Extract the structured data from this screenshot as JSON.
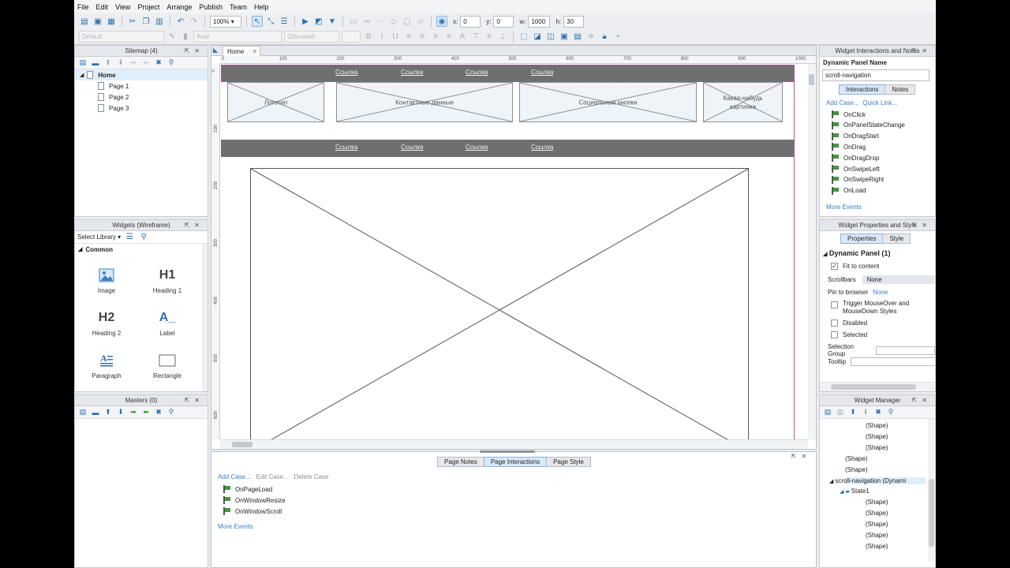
{
  "menu": [
    "File",
    "Edit",
    "View",
    "Project",
    "Arrange",
    "Publish",
    "Team",
    "Help"
  ],
  "toolbar": {
    "zoom": "100%",
    "x_label": "x:",
    "x_value": "0",
    "y_label": "y:",
    "y_value": "0",
    "w_label": "w:",
    "w_value": "1000",
    "h_label": "h:",
    "h_value": "30",
    "style_default": "Default",
    "font": "Arial",
    "font_weight": "Обычный"
  },
  "sitemap": {
    "title": "Sitemap (4)",
    "home": "Home",
    "pages": [
      "Page 1",
      "Page 2",
      "Page 3"
    ]
  },
  "widgets": {
    "title": "Widgets (Wireframe)",
    "select_library": "Select Library",
    "section": "Common",
    "items": [
      {
        "glyph": "",
        "label": "Image"
      },
      {
        "glyph": "H1",
        "label": "Heading 1"
      },
      {
        "glyph": "H2",
        "label": "Heading 2"
      },
      {
        "glyph": "A_",
        "label": "Label"
      },
      {
        "glyph": "",
        "label": "Paragraph"
      },
      {
        "glyph": "",
        "label": "Rectangle"
      }
    ]
  },
  "masters": {
    "title": "Masters (0)"
  },
  "canvas": {
    "tab": "Home",
    "ruler_h": [
      "0",
      "100",
      "200",
      "300",
      "400",
      "500",
      "600",
      "700",
      "800",
      "900",
      "1000"
    ],
    "ruler_v": [
      "0",
      "100",
      "200",
      "300",
      "400",
      "500",
      "600"
    ],
    "nav_links": [
      "Ссылка",
      "Ссылка",
      "Ссылка",
      "Ссылка"
    ],
    "nav_links_2": [
      "Ссылка",
      "Ссылка",
      "Ссылка",
      "Ссылка"
    ],
    "placeholders": [
      "Логотип",
      "Контактные данные",
      "Социальные кнопки",
      "Какая-нибудь картинка"
    ]
  },
  "page_panel": {
    "tabs": [
      "Page Notes",
      "Page Interactions",
      "Page Style"
    ],
    "add_case": "Add Case...",
    "edit_case": "Edit Case...",
    "delete_case": "Delete Case",
    "events": [
      "OnPageLoad",
      "OnWindowResize",
      "OnWindowScroll"
    ],
    "more_events": "More Events"
  },
  "interactions": {
    "title": "Widget Interactions and Notes",
    "name_label": "Dynamic Panel Name",
    "name_value": "scroll-navigation",
    "tabs": [
      "Interactions",
      "Notes"
    ],
    "add_case": "Add Case...",
    "quick_link": "Quick Link...",
    "events": [
      "OnClick",
      "OnPanelStateChange",
      "OnDragStart",
      "OnDrag",
      "OnDragDrop",
      "OnSwipeLeft",
      "OnSwipeRight",
      "OnLoad"
    ],
    "more_events": "More Events"
  },
  "properties": {
    "title": "Widget Properties and Style",
    "tabs": [
      "Properties",
      "Style"
    ],
    "section": "Dynamic Panel (1)",
    "fit_to_content": "Fit to content",
    "scrollbars_label": "Scrollbars",
    "scrollbars_value": "None",
    "pin_label": "Pin to browser",
    "pin_value": "None",
    "trigger_1": "Trigger MouseOver and",
    "trigger_2": "MouseDown Styles",
    "disabled": "Disabled",
    "selected": "Selected",
    "selection_group": "Selection Group",
    "tooltip": "Tooltip"
  },
  "widget_manager": {
    "title": "Widget Manager",
    "rows": [
      {
        "text": "(Shape)",
        "indent": 58
      },
      {
        "text": "(Shape)",
        "indent": 58
      },
      {
        "text": "(Shape)",
        "indent": 58
      },
      {
        "text": "(Shape)",
        "indent": 32
      },
      {
        "text": "(Shape)",
        "indent": 32
      },
      {
        "text": "scroll-navigation (Dynami",
        "indent": 32
      },
      {
        "text": "State1",
        "indent": 45
      },
      {
        "text": "(Shape)",
        "indent": 58
      },
      {
        "text": "(Shape)",
        "indent": 58
      },
      {
        "text": "(Shape)",
        "indent": 58
      },
      {
        "text": "(Shape)",
        "indent": 58
      },
      {
        "text": "(Shape)",
        "indent": 58
      }
    ]
  }
}
